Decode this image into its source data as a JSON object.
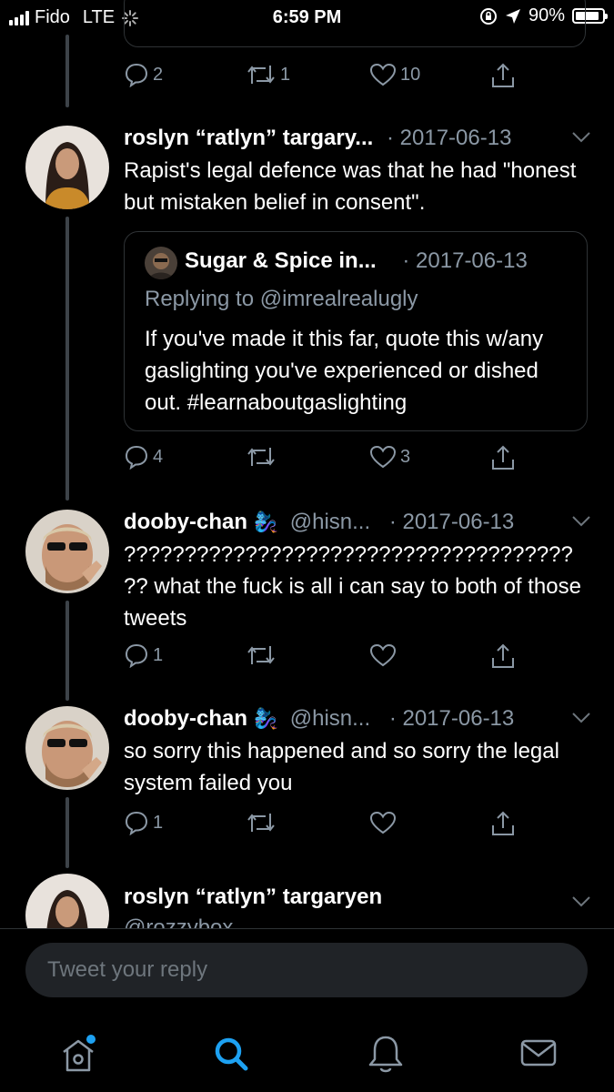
{
  "status_bar": {
    "carrier": "Fido",
    "network": "LTE",
    "time": "6:59 PM",
    "battery": "90%",
    "icons": [
      "signal-bars-icon",
      "loading-spinner-icon",
      "rotation-lock-icon",
      "location-arrow-icon",
      "battery-icon"
    ]
  },
  "prev_tweet_actions": {
    "replies": "2",
    "retweets": "1",
    "likes": "10"
  },
  "tweets": [
    {
      "name": "roslyn “ratlyn” targary...",
      "handle": "",
      "date": "· 2017-06-13",
      "text": "Rapist's legal defence was that he had \"honest but mistaken belief in consent\".",
      "quote": {
        "name": "Sugar & Spice in...",
        "date": "· 2017-06-13",
        "replying": "Replying to @imrealrealugly",
        "text": "If you've made it this far, quote this w/any gaslighting you've experienced or dished out. #learnaboutgaslighting"
      },
      "replies": "4",
      "retweets": "",
      "likes": "3"
    },
    {
      "name": "dooby-chan",
      "emoji": "🧞‍♀️",
      "handle": "@hisn...",
      "date": "· 2017-06-13",
      "text": "????????????????????????????????????? ?? what the fuck is all i can say to both of those tweets",
      "replies": "1",
      "retweets": "",
      "likes": ""
    },
    {
      "name": "dooby-chan",
      "emoji": "🧞‍♀️",
      "handle": "@hisn...",
      "date": "· 2017-06-13",
      "text": "so sorry this happened and so sorry the legal system failed you",
      "replies": "1",
      "retweets": "",
      "likes": ""
    },
    {
      "name": "roslyn “ratlyn” targaryen",
      "handle": "@rozzybox"
    }
  ],
  "reply_box": {
    "placeholder": "Tweet your reply"
  },
  "tab_bar": [
    "home-icon",
    "search-icon",
    "notifications-bell-icon",
    "messages-envelope-icon"
  ],
  "colors": {
    "background": "#000000",
    "accent": "#1da1f2",
    "secondary_text": "#8b98a5"
  }
}
